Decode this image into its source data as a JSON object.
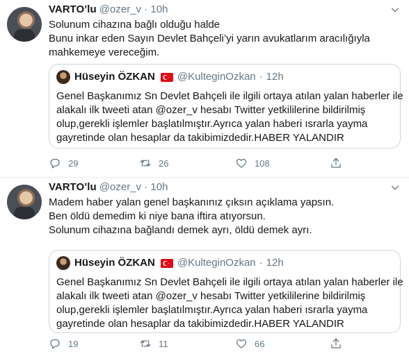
{
  "tweets": [
    {
      "name": "VARTO’lu",
      "handle": "@ozer_v",
      "dot": "·",
      "time": "10h",
      "lines": [
        "Solunum cihazına bağlı olduğu halde",
        "Bunu inkar eden Sayın Devlet Bahçeli’yi yarın avukatlarım aracılığıyla",
        "mahkemeye vereceğim."
      ],
      "quote": {
        "name": "Hüseyin ÖZKAN",
        "handle": "@KulteginOzkan",
        "dot": "·",
        "time": "12h",
        "lines": [
          "Genel Başkanımız Sn Devlet Bahçeli ile ilgili ortaya atılan yalan haberler ile",
          "alakalı ilk tweeti atan @ozer_v hesabı Twitter yetkililerine bildirilmiş",
          "olup,gerekli işlemler başlatılmıştır.Ayrıca yalan haberi ısrarla yayma",
          "gayretinde olan hesaplar da takibimizdedir.HABER YALANDIR"
        ]
      },
      "stats": {
        "replies": "29",
        "retweets": "26",
        "likes": "108"
      }
    },
    {
      "name": "VARTO’lu",
      "handle": "@ozer_v",
      "dot": "·",
      "time": "10h",
      "lines": [
        "Madem haber yalan genel başkanınız çıksın açıklama yapsın.",
        "Ben öldü demedim ki niye bana iftira atıyorsun.",
        "Solunum cihazına bağlandı demek ayrı, öldü demek ayrı."
      ],
      "quote": {
        "name": "Hüseyin ÖZKAN",
        "handle": "@KulteginOzkan",
        "dot": "·",
        "time": "12h",
        "lines": [
          "Genel Başkanımız Sn Devlet Bahçeli ile ilgili ortaya atılan yalan haberler ile",
          "alakalı ilk tweeti atan @ozer_v hesabı Twitter yetkililerine bildirilmiş",
          "olup,gerekli işlemler başlatılmıştır.Ayrıca yalan haberi ısrarla yayma",
          "gayretinde olan hesaplar da takibimizdedir.HABER YALANDIR"
        ]
      },
      "stats": {
        "replies": "19",
        "retweets": "11",
        "likes": "66"
      }
    }
  ],
  "icons": {
    "reply": "reply-icon",
    "retweet": "retweet-icon",
    "like": "heart-icon",
    "share": "share-icon",
    "more": "chevron-down-icon",
    "flag": "turkey-flag-icon"
  },
  "colors": {
    "secondary_text": "#657786",
    "border": "#e6ecf0",
    "quote_border": "#ccd6dd"
  }
}
